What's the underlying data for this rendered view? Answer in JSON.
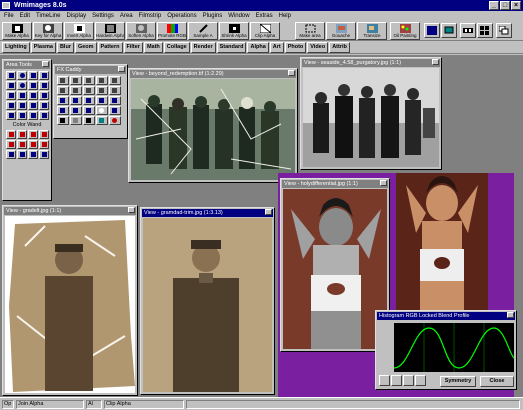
{
  "app": {
    "title": "Wmimages 8.0s",
    "buttons": [
      "_",
      "□",
      "×"
    ]
  },
  "menu": [
    "File",
    "Edit",
    "TimeLine",
    "Display",
    "Settings",
    "Area",
    "Filmstrip",
    "Operations",
    "Plugins",
    "Window",
    "Extras",
    "Help"
  ],
  "toolbar": {
    "buttons": [
      "Make Alpha",
      "Key for Alpha",
      "Invert Alpha",
      "Hardwin Alpha",
      "Soften Alpha",
      "Promote RGB",
      "Sample A",
      "Shrink Alpha",
      "Clip Alpha",
      "Make area",
      "Gouache",
      "Transize",
      "Oil Painting"
    ]
  },
  "plugin_bar": [
    "Lighting",
    "Plasma",
    "Blur",
    "Geom",
    "Pattern",
    "Filter",
    "Math",
    "Collage",
    "Render",
    "Standard",
    "Alpha",
    "Art",
    "Photo",
    "Video",
    "Attrib"
  ],
  "windows": {
    "area_tools": {
      "title": "Area Tools",
      "label": "Color Wand"
    },
    "fx_caddy": {
      "title": "FX Caddy"
    },
    "view1": {
      "title": "View - beyond_redemption.tif (1:2.29)"
    },
    "view2": {
      "title": "View - seaside_4.58_purgatory.jpg (1:1)"
    },
    "view3": {
      "title": "View - gradelt.jpg (1:1)"
    },
    "view4": {
      "title": "View - gramdad-trim.jpg (1:3.13)"
    },
    "view5": {
      "title": "View - holydifferential.jpg (1:1)"
    },
    "histogram": {
      "title": "Histogram RGB Locked Blend Profile",
      "symmetry": "Symmetry",
      "close": "Close"
    }
  },
  "statusbar": {
    "left": "Op",
    "mode": "Join Alpha",
    "chk": "Al",
    "mode2": "Clip Alpha"
  }
}
